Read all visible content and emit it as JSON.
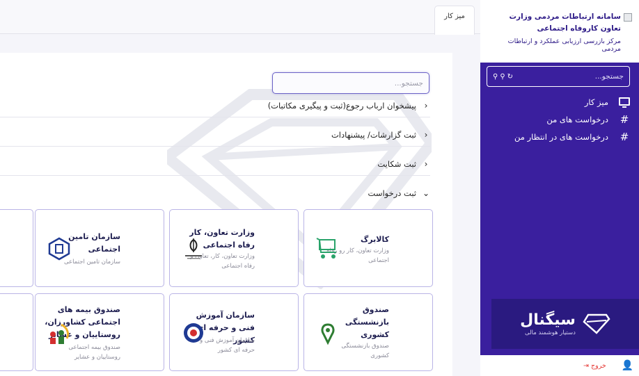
{
  "sidebar": {
    "title": "سامانه ارتباطات مردمی وزارت تعاون کاروفاه اجتماعی",
    "subtitle": "مرکز بازرسی ارزیابی عملکرد و ارتباطات مردمی",
    "search_placeholder": "جستجو...",
    "items": [
      {
        "label": "میز کار",
        "icon": "monitor-icon"
      },
      {
        "label": "درخواست های من",
        "icon": "hash-icon"
      },
      {
        "label": "درخواست های در انتظار من",
        "icon": "hash-icon"
      }
    ],
    "brand": {
      "name": "سیگنال",
      "tagline": "دستیار هوشمند مالی"
    },
    "logout_label": "خروج"
  },
  "tabs": [
    {
      "label": "میز کار"
    }
  ],
  "main": {
    "search_placeholder": "جستجو...",
    "accordion": [
      {
        "label": "پیشخوان ارباب رجوع(ثبت و پیگیری مکاتبات)",
        "expanded": false
      },
      {
        "label": "ثبت گزارشات/ پیشنهادات",
        "expanded": false
      },
      {
        "label": "ثبت شکایت",
        "expanded": false
      },
      {
        "label": "ثبت درخواست",
        "expanded": true
      }
    ],
    "cards": [
      {
        "title": "کالابرگ",
        "desc": "وزارت تعاون، کار رو رفاه اجتماعی",
        "logo": "shopping-cart-icon"
      },
      {
        "title": "وزارت تعاون، کار رفاه اجتماعی",
        "desc": "وزارت تعاون، کار، تعاون و رفاه اجتماعی",
        "logo": "iran-emblem-icon"
      },
      {
        "title": "سازمان تامین اجتماعی",
        "desc": "سازمان تامین اجتماعی",
        "logo": "social-security-logo-icon"
      },
      {
        "title": "صندوق بازنشستگی کشوری",
        "desc": "صندوق بازنشستگی کشوری",
        "logo": "pension-fund-logo-icon"
      },
      {
        "title": "سازمان آموزش فنی و حرفه ای کشور",
        "desc": "سازمان آموزش فنی و حرفه ای کشور",
        "logo": "technical-training-logo-icon"
      },
      {
        "title": "صندوق بیمه های اجتماعی کشاورزان، روستاییان و عشایر",
        "desc": "صندوق بیمه اجتماعی روستاییان و عشایر",
        "logo": "farmers-insurance-logo-icon"
      }
    ]
  },
  "colors": {
    "sidebar_bg": "#3a1f9e",
    "accent": "#6c63c7",
    "logout": "#e53935"
  }
}
